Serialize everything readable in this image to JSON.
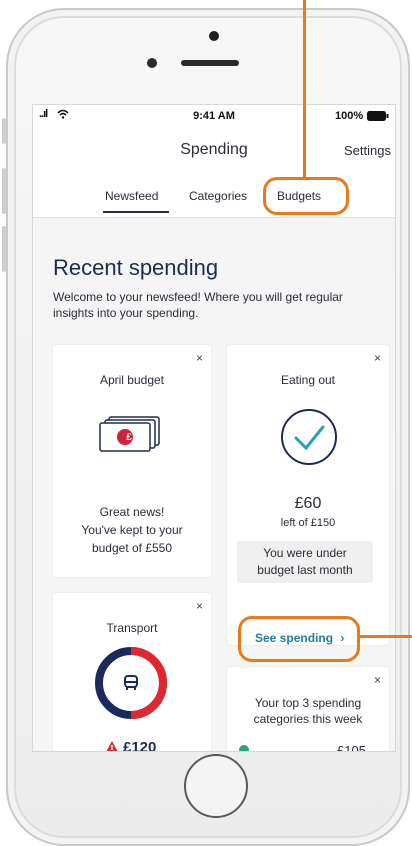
{
  "status_bar": {
    "signal": "..ıl",
    "time": "9:41 AM",
    "battery": "100%"
  },
  "nav": {
    "title": "Spending",
    "settings_label": "Settings"
  },
  "tabs": [
    {
      "label": "Newsfeed",
      "active": true
    },
    {
      "label": "Categories",
      "active": false
    },
    {
      "label": "Budgets",
      "active": false
    }
  ],
  "page": {
    "heading": "Recent spending",
    "intro": "Welcome to your newsfeed! Where you will get regular insights into your spending."
  },
  "cards": {
    "april_budget": {
      "title": "April budget",
      "line1": "Great news!",
      "line2": "You've kept to your",
      "line3": "budget of £550",
      "icon": "banknotes-icon",
      "currency_symbol": "£"
    },
    "eating_out": {
      "title": "Eating out",
      "amount": "£60",
      "left_of": "left of £150",
      "hint": "You were under budget last month",
      "icon": "checkmark-circle-icon"
    },
    "transport": {
      "title": "Transport",
      "amount": "£120",
      "icon": "bus-icon"
    },
    "top_categories": {
      "text": "Your top 3 spending categories this week",
      "amount": "£105"
    },
    "see_spending": {
      "label": "See spending",
      "chevron": "›"
    }
  },
  "close_glyph": "×",
  "colors": {
    "annotation": "#e77a1e",
    "navy": "#1f2a50",
    "link": "#1f7fa3",
    "alert_red": "#e0262f",
    "ring_navy": "#1b2a5e"
  }
}
